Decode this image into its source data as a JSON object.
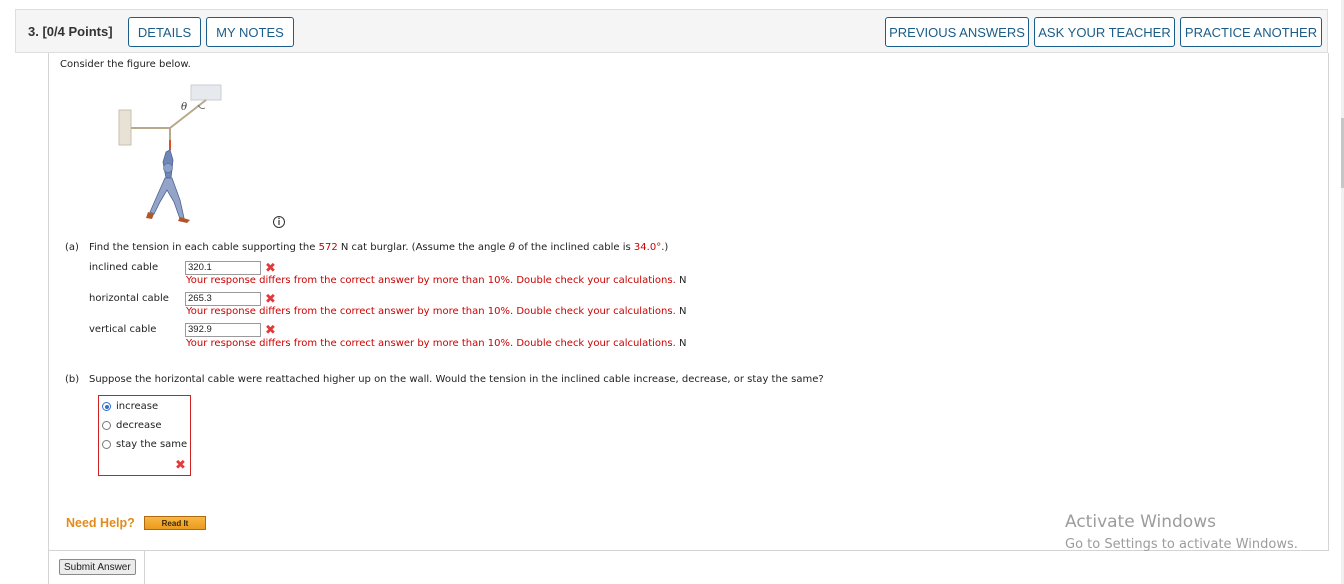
{
  "header": {
    "question_label": "3.  [0/4 Points]",
    "details_label": "DETAILS",
    "notes_label": "MY NOTES",
    "previous_label": "PREVIOUS ANSWERS",
    "ask_label": "ASK YOUR TEACHER",
    "practice_label": "PRACTICE ANOTHER"
  },
  "intro": "Consider the figure below.",
  "figure": {
    "angle_symbol": "θ",
    "info_icon": "info-icon"
  },
  "part_a": {
    "label": "(a)",
    "prompt_before": "Find the tension in each cable supporting the ",
    "weight": "572",
    "prompt_mid": " N cat burglar. (Assume the angle ",
    "theta": "θ",
    "prompt_mid2": " of the inclined cable is ",
    "angle": "34.0°",
    "prompt_end": ".)",
    "rows": [
      {
        "label": "inclined cable",
        "value": "320.1",
        "feedback": "Your response differs from the correct answer by more than 10%. Double check your calculations.",
        "unit": "N"
      },
      {
        "label": "horizontal cable",
        "value": "265.3",
        "feedback": "Your response differs from the correct answer by more than 10%. Double check your calculations.",
        "unit": "N"
      },
      {
        "label": "vertical cable",
        "value": "392.9",
        "feedback": "Your response differs from the correct answer by more than 10%. Double check your calculations.",
        "unit": "N"
      }
    ]
  },
  "part_b": {
    "label": "(b)",
    "prompt": "Suppose the horizontal cable were reattached higher up on the wall. Would the tension in the inclined cable increase, decrease, or stay the same?",
    "options": [
      "increase",
      "decrease",
      "stay the same"
    ],
    "selected": "increase"
  },
  "help": {
    "need_help": "Need Help?",
    "read_it": "Read It"
  },
  "submit_label": "Submit Answer",
  "watermark": {
    "line1": "Activate Windows",
    "line2": "Go to Settings to activate Windows."
  },
  "colors": {
    "accent": "#1a5d8a",
    "error": "#cc0000",
    "help": "#e38b1a"
  }
}
